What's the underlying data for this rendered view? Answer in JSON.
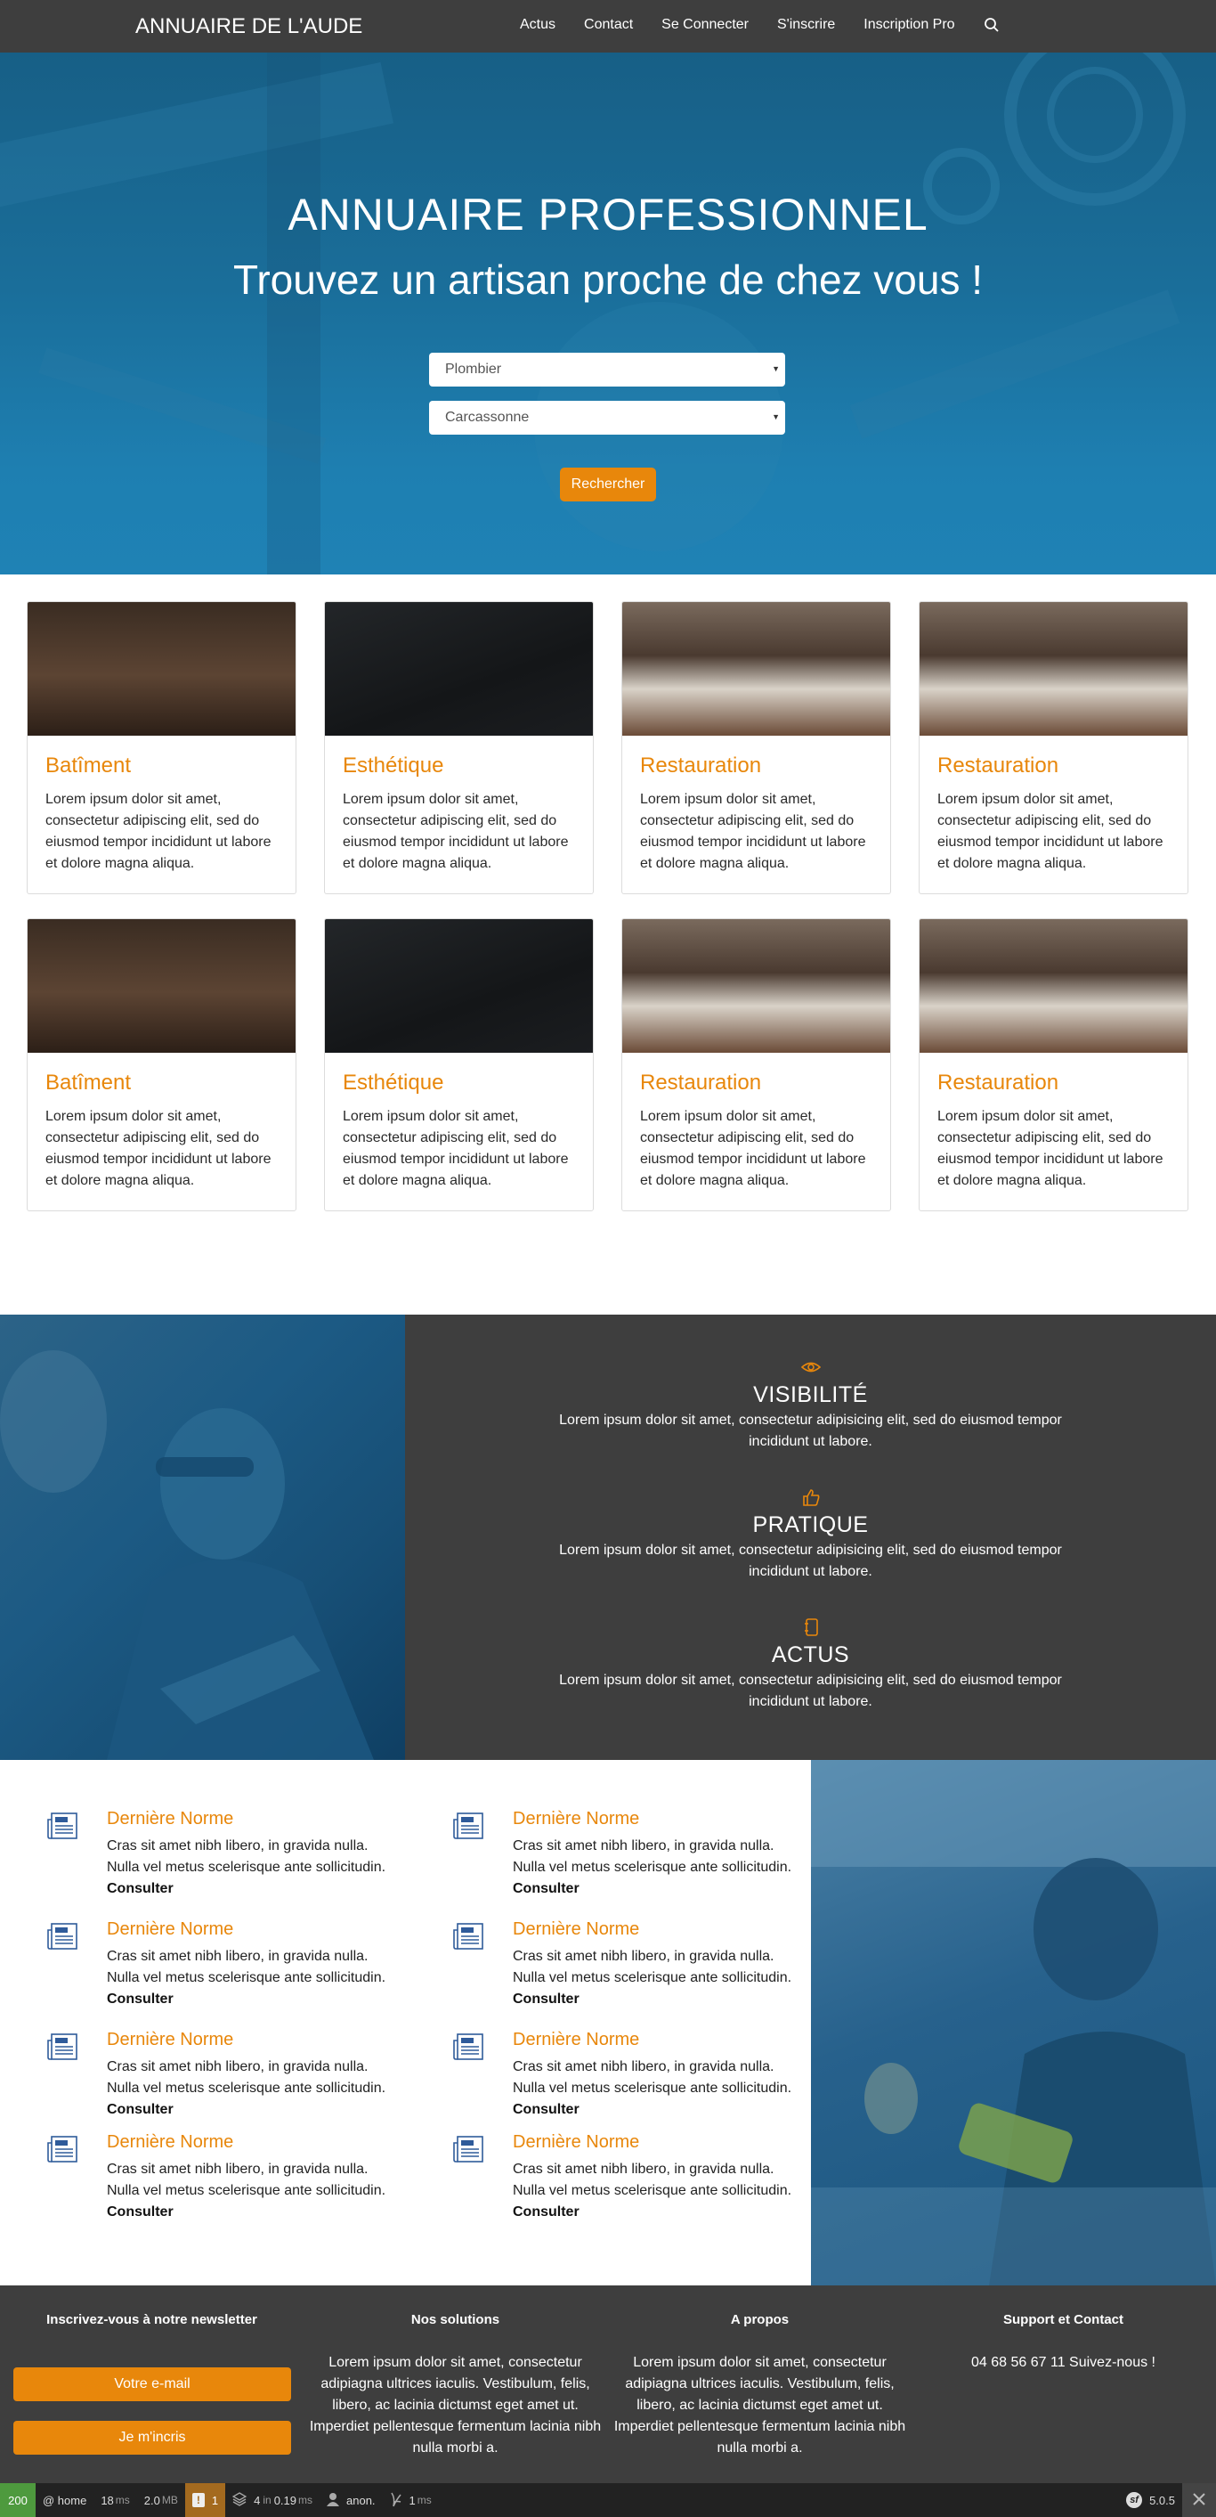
{
  "navbar": {
    "brand": "ANNUAIRE DE L'AUDE",
    "links": [
      "Actus",
      "Contact",
      "Se Connecter",
      "S'inscrire",
      "Inscription Pro"
    ],
    "search_icon": "search-icon"
  },
  "hero": {
    "title": "ANNUAIRE PROFESSIONNEL",
    "subtitle": "Trouvez un artisan proche de chez vous !",
    "trade_select": "Plombier",
    "city_select": "Carcassonne",
    "search_button": "Rechercher"
  },
  "cards": [
    {
      "title": "Batîment",
      "text": "Lorem ipsum dolor sit amet, consectetur adipiscing elit, sed do eiusmod tempor incididunt ut labore et dolore magna aliqua.",
      "image": "batiment"
    },
    {
      "title": "Esthétique",
      "text": "Lorem ipsum dolor sit amet, consectetur adipiscing elit, sed do eiusmod tempor incididunt ut labore et dolore magna aliqua.",
      "image": "esthetique"
    },
    {
      "title": "Restauration",
      "text": "Lorem ipsum dolor sit amet, consectetur adipiscing elit, sed do eiusmod tempor incididunt ut labore et dolore magna aliqua.",
      "image": "resto"
    },
    {
      "title": "Restauration",
      "text": "Lorem ipsum dolor sit amet, consectetur adipiscing elit, sed do eiusmod tempor incididunt ut labore et dolore magna aliqua.",
      "image": "resto"
    },
    {
      "title": "Batîment",
      "text": "Lorem ipsum dolor sit amet, consectetur adipiscing elit, sed do eiusmod tempor incididunt ut labore et dolore magna aliqua.",
      "image": "batiment"
    },
    {
      "title": "Esthétique",
      "text": "Lorem ipsum dolor sit amet, consectetur adipiscing elit, sed do eiusmod tempor incididunt ut labore et dolore magna aliqua.",
      "image": "esthetique"
    },
    {
      "title": "Restauration",
      "text": "Lorem ipsum dolor sit amet, consectetur adipiscing elit, sed do eiusmod tempor incididunt ut labore et dolore magna aliqua.",
      "image": "resto"
    },
    {
      "title": "Restauration",
      "text": "Lorem ipsum dolor sit amet, consectetur adipiscing elit, sed do eiusmod tempor incididunt ut labore et dolore magna aliqua.",
      "image": "resto"
    }
  ],
  "features": [
    {
      "icon": "eye-icon",
      "title": "VISIBILITÉ",
      "text": "Lorem ipsum dolor sit amet, consectetur adipisicing elit, sed do eiusmod tempor incididunt ut labore."
    },
    {
      "icon": "thumbs-up-icon",
      "title": "PRATIQUE",
      "text": "Lorem ipsum dolor sit amet, consectetur adipisicing elit, sed do eiusmod tempor incididunt ut labore."
    },
    {
      "icon": "notebook-icon",
      "title": "ACTUS",
      "text": "Lorem ipsum dolor sit amet, consectetur adipisicing elit, sed do eiusmod tempor incididunt ut labore."
    }
  ],
  "news": {
    "items": [
      {
        "title": "Dernière Norme",
        "text": "Cras sit amet nibh libero, in gravida nulla. Nulla vel metus scelerisque ante sollicitudin.",
        "link": "Consulter"
      },
      {
        "title": "Dernière Norme",
        "text": "Cras sit amet nibh libero, in gravida nulla. Nulla vel metus scelerisque ante sollicitudin.",
        "link": "Consulter"
      },
      {
        "title": "Dernière Norme",
        "text": "Cras sit amet nibh libero, in gravida nulla. Nulla vel metus scelerisque ante sollicitudin.",
        "link": "Consulter"
      },
      {
        "title": "Dernière Norme",
        "text": "Cras sit amet nibh libero, in gravida nulla. Nulla vel metus scelerisque ante sollicitudin.",
        "link": "Consulter"
      },
      {
        "title": "Dernière Norme",
        "text": "Cras sit amet nibh libero, in gravida nulla. Nulla vel metus scelerisque ante sollicitudin.",
        "link": "Consulter"
      },
      {
        "title": "Dernière Norme",
        "text": "Cras sit amet nibh libero, in gravida nulla. Nulla vel metus scelerisque ante sollicitudin.",
        "link": "Consulter"
      },
      {
        "title": "Dernière Norme",
        "text": "Cras sit amet nibh libero, in gravida nulla. Nulla vel metus scelerisque ante sollicitudin.",
        "link": "Consulter"
      },
      {
        "title": "Dernière Norme",
        "text": "Cras sit amet nibh libero, in gravida nulla. Nulla vel metus scelerisque ante sollicitudin.",
        "link": "Consulter"
      }
    ],
    "icon": "newspaper-icon"
  },
  "footer": {
    "newsletter": {
      "title": "Inscrivez-vous à notre newsletter",
      "email_button": "Votre e-mail",
      "subscribe_button": "Je m'incris"
    },
    "solutions": {
      "title": "Nos solutions",
      "text": "Lorem ipsum dolor sit amet, consectetur adipiagna ultrices iaculis. Vestibulum, felis, libero, ac lacinia dictumst eget amet ut. Imperdiet pellentesque fermentum lacinia nibh nulla morbi a."
    },
    "about": {
      "title": "A propos",
      "text": "Lorem ipsum dolor sit amet, consectetur adipiagna ultrices iaculis. Vestibulum, felis, libero, ac lacinia dictumst eget amet ut. Imperdiet pellentesque fermentum lacinia nibh nulla morbi a."
    },
    "support": {
      "title": "Support et Contact",
      "text": "04 68 56 67 11 Suivez-nous !"
    }
  },
  "debug_toolbar": {
    "status": "200",
    "route": "@ home",
    "time_value": "18",
    "time_unit": "ms",
    "memory_value": "2.0",
    "memory_unit": "MB",
    "warnings": "1",
    "db_queries": "4",
    "db_in": "in",
    "db_time": "0.19",
    "db_unit": "ms",
    "user": "anon.",
    "render_time": "1",
    "render_unit": "ms",
    "version": "5.0.5"
  },
  "colors": {
    "accent": "#e8870b",
    "dark": "#3e3e3e",
    "hero_blue": "#1a6e9a",
    "status_ok": "#4e9a3e"
  }
}
